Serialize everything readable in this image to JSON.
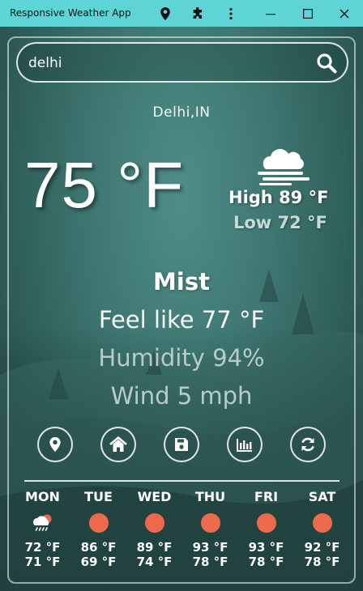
{
  "window": {
    "title": "Responsive Weather App",
    "icons": [
      "location-icon",
      "extensions-icon",
      "more-icon",
      "minimize-icon",
      "maximize-icon",
      "close-icon"
    ]
  },
  "search": {
    "value": "delhi",
    "placeholder": ""
  },
  "location": "Delhi,IN",
  "current": {
    "temperature": "75 °F",
    "icon": "mist-icon",
    "high": "High 89 °F",
    "low": "Low 72 °F",
    "description": "Mist",
    "feels_like": "Feel like 77 °F",
    "humidity": "Humidity 94%",
    "wind": "Wind 5 mph"
  },
  "actions": [
    "location-icon",
    "home-icon",
    "save-icon",
    "chart-icon",
    "refresh-icon"
  ],
  "forecast": [
    {
      "day": "MON",
      "icon": "rain-cloud-icon",
      "high": "72 °F",
      "low": "71 °F"
    },
    {
      "day": "TUE",
      "icon": "sun-icon",
      "high": "86 °F",
      "low": "69 °F"
    },
    {
      "day": "WED",
      "icon": "sun-icon",
      "high": "89 °F",
      "low": "74 °F"
    },
    {
      "day": "THU",
      "icon": "sun-icon",
      "high": "93 °F",
      "low": "78 °F"
    },
    {
      "day": "FRI",
      "icon": "sun-icon",
      "high": "93 °F",
      "low": "78 °F"
    },
    {
      "day": "SAT",
      "icon": "sun-icon",
      "high": "92 °F",
      "low": "78 °F"
    }
  ],
  "colors": {
    "titlebar": "#5fd4d6",
    "sun": "#ee6a4c",
    "accent_text": "#ffffff"
  }
}
